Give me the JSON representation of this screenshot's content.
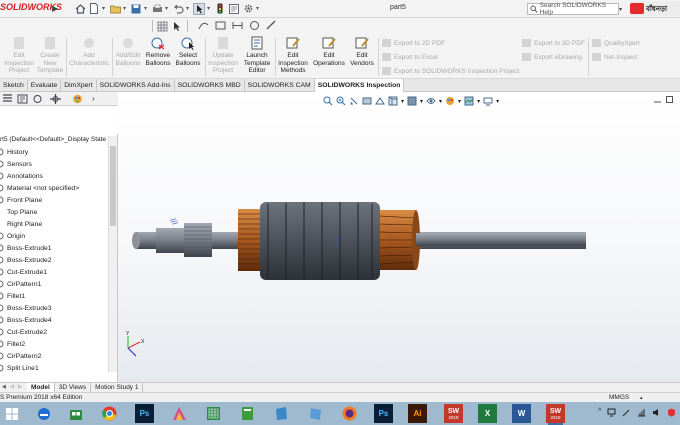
{
  "app": {
    "logo_text": "SOLIDWORKS",
    "document_title": "part5",
    "search_placeholder": "Search SOLIDWORKS Help",
    "brand_badge_text": "বাঁধনড়া"
  },
  "ribbon": {
    "buttons": [
      {
        "label_1": "Edit",
        "label_2": "Inspection",
        "label_3": "Project",
        "enabled": false
      },
      {
        "label_1": "Create",
        "label_2": "New",
        "label_3": "Template",
        "enabled": false
      },
      {
        "label_1": "Add",
        "label_2": "Characteristic",
        "label_3": "",
        "enabled": false
      },
      {
        "label_1": "Add/Edit",
        "label_2": "Balloons",
        "label_3": "",
        "enabled": false
      },
      {
        "label_1": "Remove",
        "label_2": "Balloons",
        "label_3": "",
        "enabled": true
      },
      {
        "label_1": "Select",
        "label_2": "Balloons",
        "label_3": "",
        "enabled": true
      },
      {
        "label_1": "Update",
        "label_2": "Inspection",
        "label_3": "Project",
        "enabled": false
      },
      {
        "label_1": "Launch",
        "label_2": "Template",
        "label_3": "Editor",
        "enabled": true
      },
      {
        "label_1": "Edit",
        "label_2": "Inspection",
        "label_3": "Methods",
        "enabled": true
      },
      {
        "label_1": "Edit",
        "label_2": "Operations",
        "label_3": "",
        "enabled": true
      },
      {
        "label_1": "Edit",
        "label_2": "Vendors",
        "label_3": "",
        "enabled": true
      }
    ],
    "export_items": [
      "Export to 2D PDF",
      "Export to Excel",
      "Export to SOLIDWORKS Inspection Project",
      "Export to 3D PDF",
      "Export eDrawing",
      "QualityXpert",
      "Net-Inspect"
    ]
  },
  "tabs": [
    {
      "label": "Sketch",
      "active": false
    },
    {
      "label": "Evaluate",
      "active": false
    },
    {
      "label": "DimXpert",
      "active": false
    },
    {
      "label": "SOLIDWORKS Add-Ins",
      "active": false
    },
    {
      "label": "SOLIDWORKS MBD",
      "active": false
    },
    {
      "label": "SOLIDWORKS CAM",
      "active": false
    },
    {
      "label": "SOLIDWORKS Inspection",
      "active": true
    }
  ],
  "tree": {
    "root": "rt5  (Default<<Default>_Display State",
    "items": [
      "History",
      "Sensors",
      "Annotations",
      "Material <not specified>",
      "Front Plane",
      "Top Plane",
      "Right Plane",
      "Origin",
      "Boss-Extrude1",
      "Boss-Extrude2",
      "Cut-Extrude1",
      "CirPattern1",
      "Fillet1",
      "Boss-Extrude3",
      "Boss-Extrude4",
      "Cut-Extrude2",
      "Fillet2",
      "CirPattern2",
      "Split Line1"
    ]
  },
  "bottom_tabs": [
    {
      "label": "Model",
      "active": true
    },
    {
      "label": "3D Views",
      "active": false
    },
    {
      "label": "Motion Study 1",
      "active": false
    }
  ],
  "status": {
    "edition": "S Premium 2018 x64 Edition",
    "units": "MMGS"
  },
  "taskbar": {
    "apps": [
      "windows-start",
      "edge",
      "store",
      "chrome",
      "photoshop",
      "paint-app",
      "excel-old",
      "note-app",
      "audio-app",
      "firefox",
      "photoshop-2",
      "illustrator",
      "solidworks-2018",
      "excel",
      "word",
      "solidworks-2018-active"
    ],
    "sw_badge": "SW",
    "sw_year": "2018",
    "ps_label": "Ps",
    "ai_label": "Ai",
    "x_label": "X",
    "w_label": "W"
  },
  "colors": {
    "brand_red": "#d42020",
    "active_tab_bg": "#ffffff",
    "taskbar": "#9fb9cf",
    "armature_copper": "#b6652a",
    "armature_body": "#4a4f58"
  }
}
